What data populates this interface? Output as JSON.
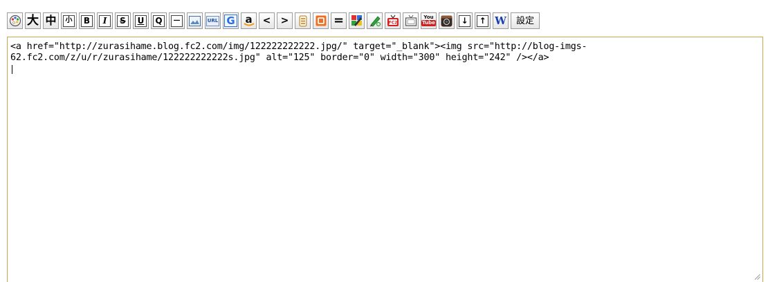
{
  "toolbar": {
    "palette_icon": "palette-icon",
    "large_text": "大",
    "medium_text": "中",
    "small_text": "小",
    "bold": "B",
    "italic": "I",
    "strike": "S",
    "underline": "U",
    "quote": "Q",
    "horizontal_rule": "—",
    "image_icon": "image-icon",
    "url": "URL",
    "google": "G",
    "amazon": "a",
    "left": "<",
    "right": ">",
    "more_icon": "more-icon",
    "blog_parts_icon": "blog-parts-icon",
    "equal": "=",
    "colors_icon": "color-picker-icon",
    "pen_icon": "pen-icon",
    "fc2_video_icon": "video-icon",
    "tv_icon": "tv-icon",
    "youtube_top": "You",
    "youtube_bottom": "Tube",
    "instagram_icon": "instagram-icon",
    "down_arrow": "↓",
    "up_arrow": "↑",
    "wikipedia": "W",
    "settings": "設定"
  },
  "editor": {
    "content": "<a href=\"http://zurasihame.blog.fc2.com/img/122222222222.jpg/\" target=\"_blank\"><img src=\"http://blog-imgs-\n62.fc2.com/z/u/r/zurasihame/122222222222s.jpg\" alt=\"125\" border=\"0\" width=\"300\" height=\"242\" /></a>"
  },
  "colors": {
    "editor_border": "#c8a64a",
    "fc2_orange": "#f36d21",
    "youtube_red": "#d21f1f",
    "wiki_blue": "#1a3fb0"
  }
}
